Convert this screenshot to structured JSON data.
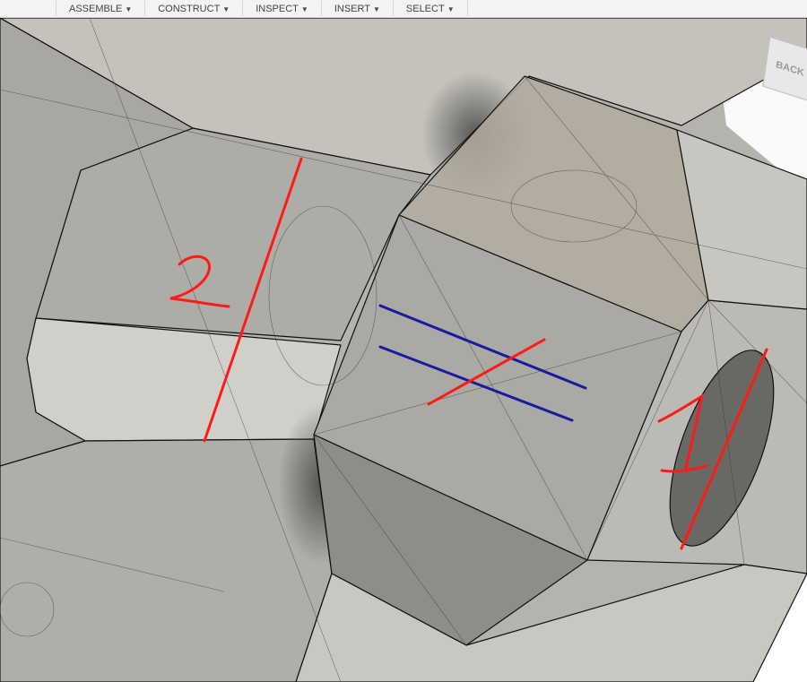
{
  "toolbar": {
    "menus": [
      {
        "label": "ASSEMBLE"
      },
      {
        "label": "CONSTRUCT"
      },
      {
        "label": "INSPECT"
      },
      {
        "label": "INSERT"
      },
      {
        "label": "SELECT"
      }
    ]
  },
  "viewcube": {
    "face_label": "BACK"
  },
  "annotations": {
    "label_2": "2",
    "label_1": "1",
    "red": "#ff1a1a",
    "blue": "#1a1aa0"
  }
}
